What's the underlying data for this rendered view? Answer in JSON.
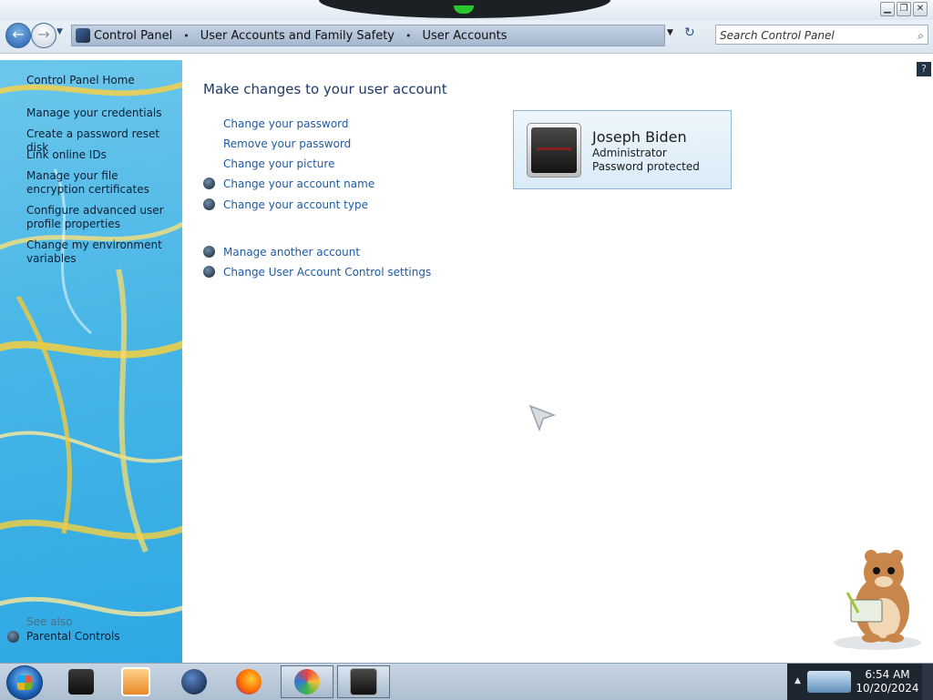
{
  "window": {
    "buttons": {
      "minimize": "▁",
      "maximize": "❐",
      "close": "✕"
    }
  },
  "address_bar": {
    "breadcrumbs": [
      "Control Panel",
      "User Accounts and Family Safety",
      "User Accounts"
    ],
    "separator": "•",
    "dropdown_arrow": "▼",
    "refresh_glyph": "↻",
    "search_placeholder": "Search Control Panel",
    "search_icon": "search-icon"
  },
  "nav": {
    "back_glyph": "←",
    "forward_glyph": "→",
    "history_glyph": "▼"
  },
  "sidebar": {
    "home": "Control Panel Home",
    "links": [
      "Manage your credentials",
      "Create a password reset disk",
      "Link online IDs",
      "Manage your file encryption certificates",
      "Configure advanced user profile properties",
      "Change my environment variables"
    ],
    "see_also_label": "See also",
    "see_also_links": [
      "Parental Controls"
    ]
  },
  "main": {
    "heading": "Make changes to your user account",
    "tasks": [
      {
        "label": "Change your password",
        "shield": false
      },
      {
        "label": "Remove your password",
        "shield": false
      },
      {
        "label": "Change your picture",
        "shield": false
      },
      {
        "label": "Change your account name",
        "shield": true
      },
      {
        "label": "Change your account type",
        "shield": true
      }
    ],
    "other_tasks": [
      {
        "label": "Manage another account",
        "shield": true
      },
      {
        "label": "Change User Account Control settings",
        "shield": true
      }
    ],
    "help_glyph": "?"
  },
  "user": {
    "name": "Joseph Biden",
    "role": "Administrator",
    "status": "Password protected"
  },
  "taskbar": {
    "pinned": [
      "folder-icon",
      "media-player-icon",
      "globe-icon",
      "firefox-icon",
      "paint-icon",
      "monitor-app-icon"
    ],
    "tray_arrow": "▲",
    "time": "6:54 AM",
    "date": "10/20/2024"
  },
  "colors": {
    "link": "#1e5ba3",
    "heading": "#1e3b6b",
    "sidebar_bg": "#48b6e6",
    "taskbar": "#aebfd1"
  }
}
